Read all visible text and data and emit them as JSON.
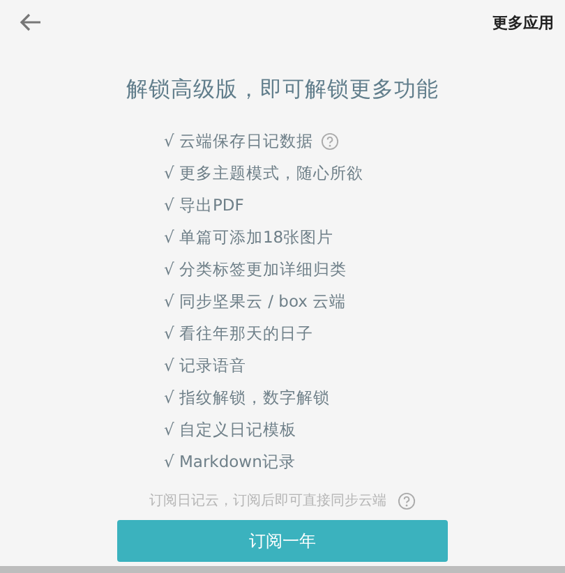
{
  "header": {
    "more_apps": "更多应用"
  },
  "title": "解锁高级版，即可解锁更多功能",
  "features": [
    {
      "text": "√ 云端保存日记数据",
      "help": true
    },
    {
      "text": "√ 更多主题模式，随心所欲",
      "help": false
    },
    {
      "text": "√ 导出PDF",
      "help": false
    },
    {
      "text": "√ 单篇可添加18张图片",
      "help": false
    },
    {
      "text": "√ 分类标签更加详细归类",
      "help": false
    },
    {
      "text": "√ 同步坚果云 / box 云端",
      "help": false
    },
    {
      "text": "√ 看往年那天的日子",
      "help": false
    },
    {
      "text": "√ 记录语音",
      "help": false
    },
    {
      "text": "√ 指纹解锁，数字解锁",
      "help": false
    },
    {
      "text": "√ 自定义日记模板",
      "help": false
    },
    {
      "text": "√ Markdown记录",
      "help": false
    }
  ],
  "note": {
    "text": "订阅日记云，订阅后即可直接同步云端",
    "help": true
  },
  "subscribe_button": "订阅一年"
}
